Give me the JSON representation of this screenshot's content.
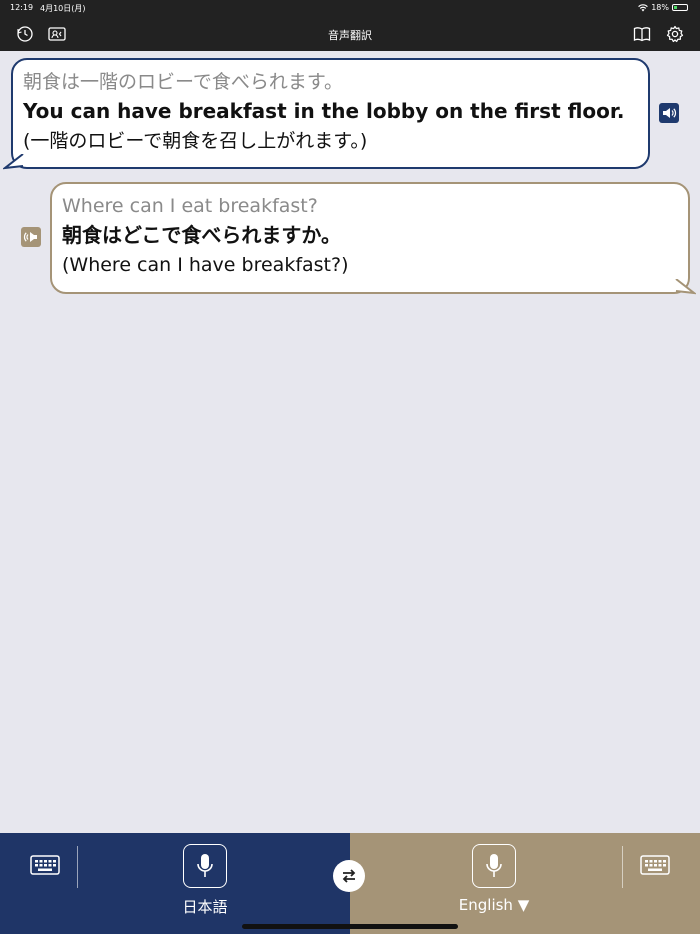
{
  "status_bar": {
    "time": "12:19",
    "date": "4月10日(月)",
    "battery": "18%"
  },
  "nav": {
    "title": "音声翻訳",
    "icons": [
      "history-icon",
      "conversation-mode-icon",
      "book-icon",
      "settings-icon"
    ]
  },
  "conversation": [
    {
      "side": "left",
      "color": "#1f3a6e",
      "source": "朝食は一階のロビーで食べられます。",
      "translation": "You can have breakfast in the lobby on the first floor.",
      "back_translation": "(一階のロビーで朝食を召し上がれます。)"
    },
    {
      "side": "right",
      "color": "#a59477",
      "source": "Where can I eat breakfast?",
      "translation": "朝食はどこで食べられますか。",
      "back_translation": "(Where can I have breakfast?)"
    }
  ],
  "bottom_bar": {
    "left_language": "日本語",
    "right_language": "English ▼",
    "left_color": "#1f3567",
    "right_color": "#a59477"
  }
}
